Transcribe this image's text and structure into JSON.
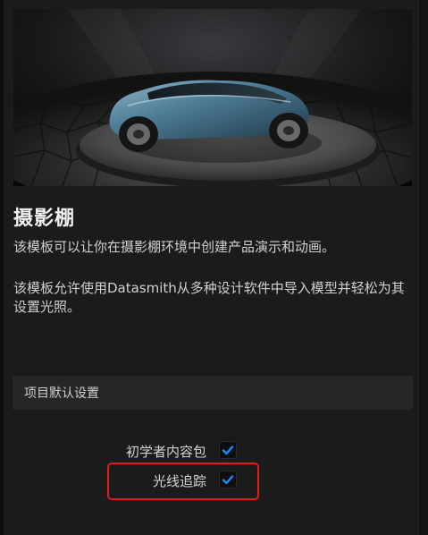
{
  "template": {
    "title": "摄影棚",
    "description_1": "该模板可以让你在摄影棚环境中创建产品演示和动画。",
    "description_2": "该模板允许使用Datasmith从多种设计软件中导入模型并轻松为其设置光照。",
    "preview_image": "car-studio-render"
  },
  "project_defaults": {
    "header": "项目默认设置",
    "options": [
      {
        "label": "初学者内容包",
        "checked": true
      },
      {
        "label": "光线追踪",
        "checked": true,
        "highlighted": true
      }
    ]
  },
  "colors": {
    "checkmark": "#1a8cff",
    "highlight_border": "#e01c1c"
  }
}
